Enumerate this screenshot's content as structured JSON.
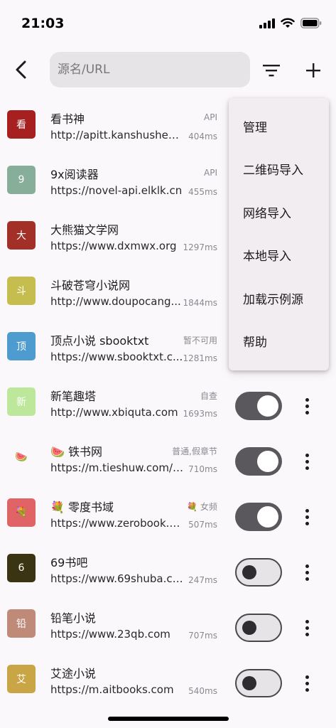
{
  "status_bar": {
    "time": "21:03"
  },
  "search": {
    "placeholder": "源名/URL"
  },
  "sources": [
    {
      "avatar": "看",
      "avatar_color": "#a5201e",
      "name": "看书神",
      "tag": "API",
      "url": "http://apitt.kanshushen...",
      "ms": "404ms",
      "toggle": null
    },
    {
      "avatar": "9",
      "avatar_color": "#86ae98",
      "name": "9x阅读器",
      "tag": "API",
      "url": "https://novel-api.elklk.cn",
      "ms": "455ms",
      "toggle": null
    },
    {
      "avatar": "大",
      "avatar_color": "#a33027",
      "name": "大熊猫文学网",
      "tag": "",
      "url": "https://www.dxmwx.org",
      "ms": "1297ms",
      "toggle": null
    },
    {
      "avatar": "斗",
      "avatar_color": "#c5bd4d",
      "name": "斗破苍穹小说网",
      "tag": "",
      "url": "http://www.doupocang...",
      "ms": "1844ms",
      "toggle": null
    },
    {
      "avatar": "顶",
      "avatar_color": "#4e9bd0",
      "name": "顶点小说 sbooktxt",
      "tag": "暂不可用",
      "url": "https://www.sbooktxt.c...",
      "ms": "1281ms",
      "toggle": null
    },
    {
      "avatar": "新",
      "avatar_color": "#bde79a",
      "name": "新笔趣塔",
      "tag": "自查",
      "url": "http://www.xbiquta.com",
      "ms": "1693ms",
      "toggle": "on"
    },
    {
      "avatar": "🍉",
      "avatar_color": "transparent",
      "name": "🍉 铁书网",
      "tag": "普通,假章节",
      "url": "https://m.tieshuw.com/#...",
      "ms": "710ms",
      "toggle": "on"
    },
    {
      "avatar": "💐",
      "avatar_color": "#e06465",
      "name": "💐 零度书域",
      "tag": "💐 女频",
      "url": "https://www.zerobook.me",
      "ms": "507ms",
      "toggle": "on"
    },
    {
      "avatar": "6",
      "avatar_color": "#3b3412",
      "name": "69书吧",
      "tag": "",
      "url": "https://www.69shuba.co...",
      "ms": "247ms",
      "toggle": "off"
    },
    {
      "avatar": "铅",
      "avatar_color": "#c08a78",
      "name": "铅笔小说",
      "tag": "",
      "url": "https://www.23qb.com",
      "ms": "707ms",
      "toggle": "off"
    },
    {
      "avatar": "艾",
      "avatar_color": "#c9a545",
      "name": "艾途小说",
      "tag": "",
      "url": "https://m.aitbooks.com",
      "ms": "540ms",
      "toggle": "off"
    }
  ],
  "menu": {
    "items": [
      "管理",
      "二维码导入",
      "网络导入",
      "本地导入",
      "加载示例源",
      "帮助"
    ]
  },
  "icons": {
    "back": "back-arrow-icon",
    "filter": "filter-icon",
    "add": "plus-icon",
    "more": "more-vert-icon",
    "signal": "signal-icon",
    "wifi": "wifi-icon",
    "battery": "battery-icon"
  }
}
